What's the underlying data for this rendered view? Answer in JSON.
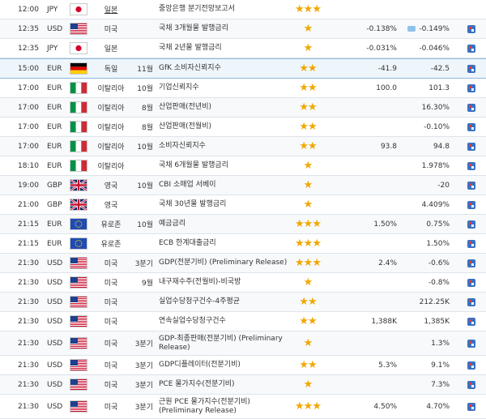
{
  "rows": [
    {
      "time": "12:00",
      "cur": "JPY",
      "flag": "jp",
      "country": "일본",
      "period": "",
      "event": "중앙은행 분기전망보고서",
      "stars": "★★★",
      "actual": "",
      "forecast": "",
      "comment": false
    },
    {
      "time": "12:35",
      "cur": "USD",
      "flag": "us",
      "country": "미국",
      "period": "",
      "event": "국채 3개월물 발행금리",
      "stars": "★",
      "actual": "-0.138%",
      "forecast": "-0.149%",
      "comment": true
    },
    {
      "time": "12:35",
      "cur": "JPY",
      "flag": "jp",
      "country": "일본",
      "period": "",
      "event": "국채 2년물 발행금리",
      "stars": "★",
      "actual": "-0.031%",
      "forecast": "-0.046%",
      "comment": false
    },
    {
      "time": "15:00",
      "cur": "EUR",
      "flag": "de",
      "country": "독일",
      "period": "11월",
      "event": "GfK 소비자신뢰지수",
      "stars": "★★",
      "actual": "-41.9",
      "forecast": "-42.5",
      "comment": false
    },
    {
      "time": "17:00",
      "cur": "EUR",
      "flag": "it",
      "country": "이탈리아",
      "period": "10월",
      "event": "기업신뢰지수",
      "stars": "★★",
      "actual": "100.0",
      "forecast": "101.3",
      "comment": false
    },
    {
      "time": "17:00",
      "cur": "EUR",
      "flag": "it",
      "country": "이탈리아",
      "period": "8월",
      "event": "산업판매(전년비)",
      "stars": "★★",
      "actual": "",
      "forecast": "16.30%",
      "comment": false
    },
    {
      "time": "17:00",
      "cur": "EUR",
      "flag": "it",
      "country": "이탈리아",
      "period": "8월",
      "event": "산업판매(전월비)",
      "stars": "★★",
      "actual": "",
      "forecast": "-0.10%",
      "comment": false
    },
    {
      "time": "17:00",
      "cur": "EUR",
      "flag": "it",
      "country": "이탈리아",
      "period": "10월",
      "event": "소비자신뢰지수",
      "stars": "★★",
      "actual": "93.8",
      "forecast": "94.8",
      "comment": false
    },
    {
      "time": "18:10",
      "cur": "EUR",
      "flag": "it",
      "country": "이탈리아",
      "period": "",
      "event": "국채 6개월물 발행금리",
      "stars": "★",
      "actual": "",
      "forecast": "1.978%",
      "comment": false
    },
    {
      "time": "19:00",
      "cur": "GBP",
      "flag": "gb",
      "country": "영국",
      "period": "10월",
      "event": "CBI 소매업 서베이",
      "stars": "★",
      "actual": "",
      "forecast": "-20",
      "comment": false
    },
    {
      "time": "21:00",
      "cur": "GBP",
      "flag": "gb",
      "country": "영국",
      "period": "",
      "event": "국채 30년물 발행금리",
      "stars": "★",
      "actual": "",
      "forecast": "4.409%",
      "comment": false
    },
    {
      "time": "21:15",
      "cur": "EUR",
      "flag": "eu",
      "country": "유로존",
      "period": "10월",
      "event": "예금금리",
      "stars": "★★★",
      "actual": "1.50%",
      "forecast": "0.75%",
      "comment": false
    },
    {
      "time": "21:15",
      "cur": "EUR",
      "flag": "eu",
      "country": "유로존",
      "period": "",
      "event": "ECB 한계대출금리",
      "stars": "★★★",
      "actual": "",
      "forecast": "1.50%",
      "comment": false
    },
    {
      "time": "21:30",
      "cur": "USD",
      "flag": "us",
      "country": "미국",
      "period": "3분기",
      "event": "GDP(전분기비) (Preliminary Release)",
      "stars": "★★★",
      "actual": "2.4%",
      "forecast": "-0.6%",
      "comment": false
    },
    {
      "time": "21:30",
      "cur": "USD",
      "flag": "us",
      "country": "미국",
      "period": "9월",
      "event": "내구재수주(전월비)-비국방",
      "stars": "★",
      "actual": "",
      "forecast": "-0.8%",
      "comment": false
    },
    {
      "time": "21:30",
      "cur": "USD",
      "flag": "us",
      "country": "미국",
      "period": "",
      "event": "실업수당청구건수-4주평균",
      "stars": "★★",
      "actual": "",
      "forecast": "212.25K",
      "comment": false
    },
    {
      "time": "21:30",
      "cur": "USD",
      "flag": "us",
      "country": "미국",
      "period": "",
      "event": "연속실업수당청구건수",
      "stars": "★★",
      "actual": "1,388K",
      "forecast": "1,385K",
      "comment": false
    },
    {
      "time": "21:30",
      "cur": "USD",
      "flag": "us",
      "country": "미국",
      "period": "3분기",
      "event": "GDP-최종판매(전분기비) (Preliminary Release)",
      "stars": "★",
      "actual": "",
      "forecast": "1.3%",
      "comment": false
    },
    {
      "time": "21:30",
      "cur": "USD",
      "flag": "us",
      "country": "미국",
      "period": "3분기",
      "event": "GDP디플레이터(전분기비)",
      "stars": "★★",
      "actual": "5.3%",
      "forecast": "9.1%",
      "comment": false
    },
    {
      "time": "21:30",
      "cur": "USD",
      "flag": "us",
      "country": "미국",
      "period": "3분기",
      "event": "PCE 물가지수(전분기비)",
      "stars": "★",
      "actual": "",
      "forecast": "7.3%",
      "comment": false
    },
    {
      "time": "21:30",
      "cur": "USD",
      "flag": "us",
      "country": "미국",
      "period": "3분기",
      "event": "근원 PCE 물가지수(전분기비) (Preliminary Release)",
      "stars": "★★★",
      "actual": "4.50%",
      "forecast": "4.70%",
      "comment": false
    }
  ]
}
